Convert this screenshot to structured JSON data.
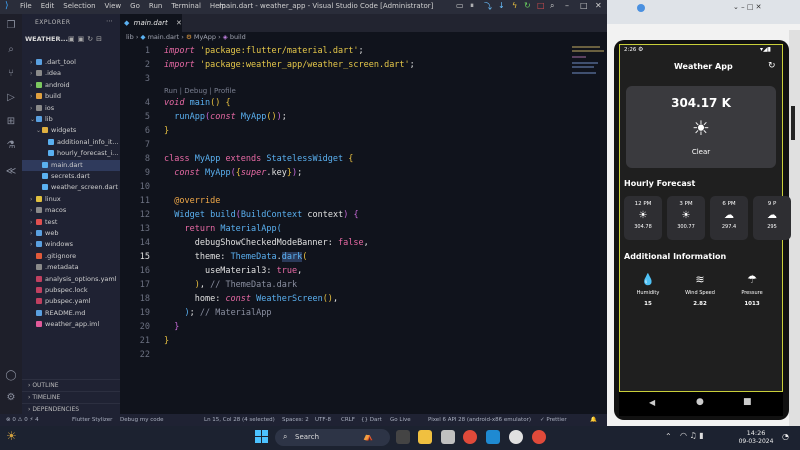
{
  "vscode": {
    "title": "main.dart - weather_app - Visual Studio Code [Administrator]",
    "menu": [
      "File",
      "Edit",
      "Selection",
      "View",
      "Go",
      "Run",
      "Terminal",
      "Help"
    ],
    "explorer_header": "EXPLORER",
    "project": "WEATHER...",
    "tree": [
      {
        "label": ".dart_tool",
        "type": "folder",
        "indent": 1,
        "color": "#5aa0e0"
      },
      {
        "label": ".idea",
        "type": "folder",
        "indent": 1,
        "color": "#8a8a8a"
      },
      {
        "label": "android",
        "type": "folder",
        "indent": 1,
        "color": "#7cc860"
      },
      {
        "label": "build",
        "type": "folder",
        "indent": 1,
        "color": "#e0a040"
      },
      {
        "label": "ios",
        "type": "folder",
        "indent": 1,
        "color": "#8a8a8a"
      },
      {
        "label": "lib",
        "type": "folder-open",
        "indent": 1,
        "color": "#5aa0e0"
      },
      {
        "label": "widgets",
        "type": "folder-open",
        "indent": 2,
        "color": "#e0b040"
      },
      {
        "label": "additional_info_it...",
        "type": "file",
        "indent": 3,
        "color": "#5ab0f0"
      },
      {
        "label": "hourly_forecast_i...",
        "type": "file",
        "indent": 3,
        "color": "#5ab0f0"
      },
      {
        "label": "main.dart",
        "type": "file",
        "indent": 2,
        "color": "#5ab0f0",
        "selected": true
      },
      {
        "label": "secrets.dart",
        "type": "file",
        "indent": 2,
        "color": "#5ab0f0"
      },
      {
        "label": "weather_screen.dart",
        "type": "file",
        "indent": 2,
        "color": "#5ab0f0"
      },
      {
        "label": "linux",
        "type": "folder",
        "indent": 1,
        "color": "#e0c040"
      },
      {
        "label": "macos",
        "type": "folder",
        "indent": 1,
        "color": "#8a8a8a"
      },
      {
        "label": "test",
        "type": "folder",
        "indent": 1,
        "color": "#e05050"
      },
      {
        "label": "web",
        "type": "folder",
        "indent": 1,
        "color": "#5aa0e0"
      },
      {
        "label": "windows",
        "type": "folder",
        "indent": 1,
        "color": "#5aa0e0"
      },
      {
        "label": ".gitignore",
        "type": "file",
        "indent": 1,
        "color": "#e05a3a"
      },
      {
        "label": ".metadata",
        "type": "file",
        "indent": 1,
        "color": "#8a8a8a"
      },
      {
        "label": "analysis_options.yaml",
        "type": "file",
        "indent": 1,
        "color": "#c04060"
      },
      {
        "label": "pubspec.lock",
        "type": "file",
        "indent": 1,
        "color": "#c04060"
      },
      {
        "label": "pubspec.yaml",
        "type": "file",
        "indent": 1,
        "color": "#c04060"
      },
      {
        "label": "README.md",
        "type": "file",
        "indent": 1,
        "color": "#5aa0e0"
      },
      {
        "label": "weather_app.iml",
        "type": "file",
        "indent": 1,
        "color": "#e05a9a"
      }
    ],
    "bottom_sections": [
      "OUTLINE",
      "TIMELINE",
      "DEPENDENCIES"
    ],
    "tab": "main.dart",
    "breadcrumb": [
      "lib",
      "main.dart",
      "MyApp",
      "build"
    ],
    "code_lens": "Run | Debug | Profile",
    "status": {
      "left": "⊗ 0 ⚠ 0  ⚡ 4",
      "stylizer": "Flutter Stylizer",
      "debug": "Debug my code",
      "position": "Ln 15, Col 28 (4 selected)",
      "spaces": "Spaces: 2",
      "encoding": "UTF-8",
      "eol": "CRLF",
      "lang": "{} Dart",
      "golive": "Go Live",
      "device": "Pixel 6 API 28 (android-x86 emulator)",
      "prettier": "✓ Prettier"
    }
  },
  "emulator": {
    "time": "2:26",
    "app_title": "Weather App",
    "temperature": "304.17 K",
    "condition": "Clear",
    "hourly_title": "Hourly Forecast",
    "hourly": [
      {
        "time": "12 PM",
        "icon": "sun",
        "value": "304.78"
      },
      {
        "time": "3 PM",
        "icon": "sun",
        "value": "300.77"
      },
      {
        "time": "6 PM",
        "icon": "cloud",
        "value": "297.4"
      },
      {
        "time": "9 P",
        "icon": "cloud",
        "value": "295"
      }
    ],
    "additional_title": "Additional Information",
    "additional": [
      {
        "label": "Humidity",
        "value": "15",
        "icon": "water-drop"
      },
      {
        "label": "Wind Speed",
        "value": "2.82",
        "icon": "wind"
      },
      {
        "label": "Pressure",
        "value": "1013",
        "icon": "umbrella"
      }
    ]
  },
  "taskbar": {
    "search": "Search",
    "time": "14:26",
    "date": "09-03-2024"
  }
}
